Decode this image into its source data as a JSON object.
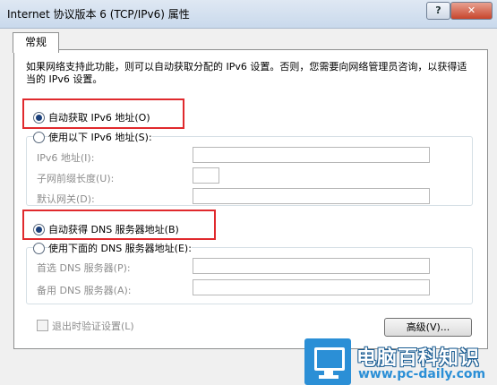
{
  "window": {
    "title": "Internet 协议版本 6 (TCP/IPv6) 属性",
    "help_label": "?",
    "close_label": "✕"
  },
  "tab": {
    "label": "常规"
  },
  "description": "如果网络支持此功能，则可以自动获取分配的 IPv6 设置。否则，您需要向网络管理员咨询，以获得适当的 IPv6 设置。",
  "ipv6": {
    "auto_label": "自动获取 IPv6 地址(O)",
    "manual_label": "使用以下 IPv6 地址(S):",
    "auto_selected": true,
    "fields": [
      {
        "label": "IPv6 地址(I):",
        "value": ""
      },
      {
        "label": "子网前缀长度(U):",
        "value": ""
      },
      {
        "label": "默认网关(D):",
        "value": ""
      }
    ]
  },
  "dns": {
    "auto_label": "自动获得 DNS 服务器地址(B)",
    "manual_label": "使用下面的 DNS 服务器地址(E):",
    "auto_selected": true,
    "fields": [
      {
        "label": "首选 DNS 服务器(P):",
        "value": ""
      },
      {
        "label": "备用 DNS 服务器(A):",
        "value": ""
      }
    ]
  },
  "validate_label": "退出时验证设置(L)",
  "advanced_label": "高级(V)...",
  "watermark": {
    "title": "电脑百科知识",
    "url": "www.pc-daily.com"
  },
  "colors": {
    "highlight_box": "#e0292d",
    "watermark_blue": "#2b8fd6"
  }
}
